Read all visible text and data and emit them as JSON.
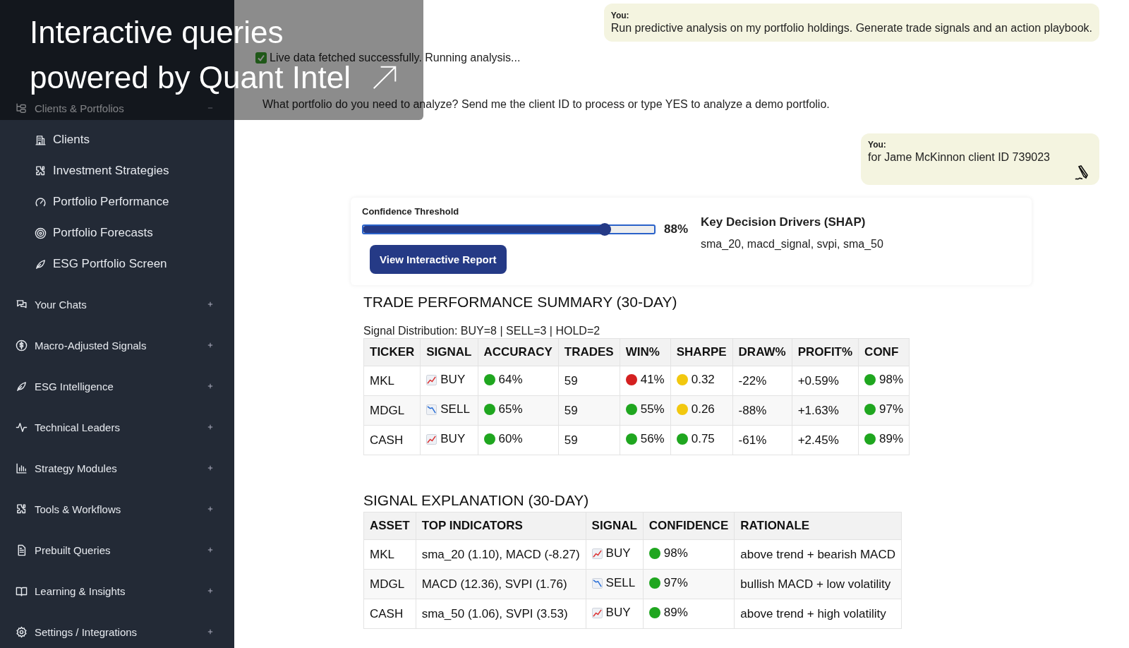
{
  "caption": {
    "lines": [
      "Interactive queries",
      "powered by Quant Intel"
    ]
  },
  "sidebar": {
    "items": [
      {
        "label": "Clients & Portfolios",
        "expanded": true,
        "children": [
          {
            "label": "Clients"
          },
          {
            "label": "Investment Strategies"
          },
          {
            "label": "Portfolio Performance"
          },
          {
            "label": "Portfolio Forecasts"
          },
          {
            "label": "ESG Portfolio Screen"
          }
        ]
      },
      {
        "label": "Your Chats",
        "expanded": false
      },
      {
        "label": "Macro-Adjusted Signals",
        "expanded": false
      },
      {
        "label": "ESG Intelligence",
        "expanded": false
      },
      {
        "label": "Technical Leaders",
        "expanded": false
      },
      {
        "label": "Strategy Modules",
        "expanded": false
      },
      {
        "label": "Tools & Workflows",
        "expanded": false
      },
      {
        "label": "Prebuilt Queries",
        "expanded": false
      },
      {
        "label": "Learning & Insights",
        "expanded": false
      },
      {
        "label": "Settings / Integrations",
        "expanded": false
      }
    ]
  },
  "messages": [
    {
      "kind": "user",
      "sender": "You:",
      "text": "Run predictive analysis on my portfolio holdings. Generate trade signals and an action playbook."
    },
    {
      "kind": "status",
      "text": "Live data fetched successfully. Running analysis..."
    },
    {
      "kind": "assistant",
      "text": "What portfolio do you need to analyze? Send me the client ID to process or type YES to analyze a demo portfolio."
    },
    {
      "kind": "user",
      "sender": "You:",
      "text": "for Jame McKinnon client ID 739023",
      "editable": true
    }
  ],
  "report": {
    "threshold_label": "Confidence Threshold",
    "level": 0.83,
    "reading": "88%",
    "button": "View Interactive Report",
    "drivers_title": "Key Decision Drivers (SHAP)",
    "drivers": "sma_20, macd_signal, svpi, sma_50"
  },
  "performance": {
    "title": "TRADE PERFORMANCE SUMMARY (30-DAY)",
    "distribution": "Signal Distribution: BUY=8 | SELL=3 | HOLD=2",
    "columns": [
      "TICKER",
      "SIGNAL",
      "ACCURACY",
      "TRADES",
      "WIN%",
      "SHARPE",
      "DRAW%",
      "PROFIT%",
      "CONF"
    ],
    "rows": [
      [
        {
          "text": "MKL"
        },
        {
          "kind": "rising",
          "text": "BUY"
        },
        {
          "kind": "dot",
          "color": "#1fa61f",
          "text": "64%"
        },
        {
          "text": "59"
        },
        {
          "kind": "dot",
          "color": "#d42020",
          "text": "41%"
        },
        {
          "kind": "dot",
          "color": "#f2c80f",
          "text": "0.32"
        },
        {
          "text": "-22%"
        },
        {
          "text": "+0.59%"
        },
        {
          "kind": "dot",
          "color": "#1fa61f",
          "text": "98%"
        }
      ],
      [
        {
          "text": "MDGL"
        },
        {
          "kind": "falling",
          "text": "SELL"
        },
        {
          "kind": "dot",
          "color": "#1fa61f",
          "text": "65%"
        },
        {
          "text": "59"
        },
        {
          "kind": "dot",
          "color": "#1fa61f",
          "text": "55%"
        },
        {
          "kind": "dot",
          "color": "#f2c80f",
          "text": "0.26"
        },
        {
          "text": "-88%"
        },
        {
          "text": "+1.63%"
        },
        {
          "kind": "dot",
          "color": "#1fa61f",
          "text": "97%"
        }
      ],
      [
        {
          "text": "CASH"
        },
        {
          "kind": "rising",
          "text": "BUY"
        },
        {
          "kind": "dot",
          "color": "#1fa61f",
          "text": "60%"
        },
        {
          "text": "59"
        },
        {
          "kind": "dot",
          "color": "#1fa61f",
          "text": "56%"
        },
        {
          "kind": "dot",
          "color": "#1fa61f",
          "text": "0.75"
        },
        {
          "text": "-61%"
        },
        {
          "text": "+2.45%"
        },
        {
          "kind": "dot",
          "color": "#1fa61f",
          "text": "89%"
        }
      ]
    ]
  },
  "explanation": {
    "title": "SIGNAL EXPLANATION (30-DAY)",
    "columns": [
      "ASSET",
      "TOP INDICATORS",
      "SIGNAL",
      "CONFIDENCE",
      "RATIONALE"
    ],
    "rows": [
      [
        {
          "text": "MKL"
        },
        {
          "text": "sma_20 (1.10), MACD (-8.27)"
        },
        {
          "kind": "rising",
          "text": "BUY"
        },
        {
          "kind": "dot",
          "color": "#1fa61f",
          "text": "98%"
        },
        {
          "text": "above trend + bearish MACD"
        }
      ],
      [
        {
          "text": "MDGL"
        },
        {
          "text": "MACD (12.36), SVPI (1.76)"
        },
        {
          "kind": "falling",
          "text": "SELL"
        },
        {
          "kind": "dot",
          "color": "#1fa61f",
          "text": "97%"
        },
        {
          "text": "bullish MACD + low volatility"
        }
      ],
      [
        {
          "text": "CASH"
        },
        {
          "text": "sma_50 (1.06), SVPI (3.53)"
        },
        {
          "kind": "rising",
          "text": "BUY"
        },
        {
          "kind": "dot",
          "color": "#1fa61f",
          "text": "89%"
        },
        {
          "text": "above trend + high volatility"
        }
      ]
    ]
  }
}
